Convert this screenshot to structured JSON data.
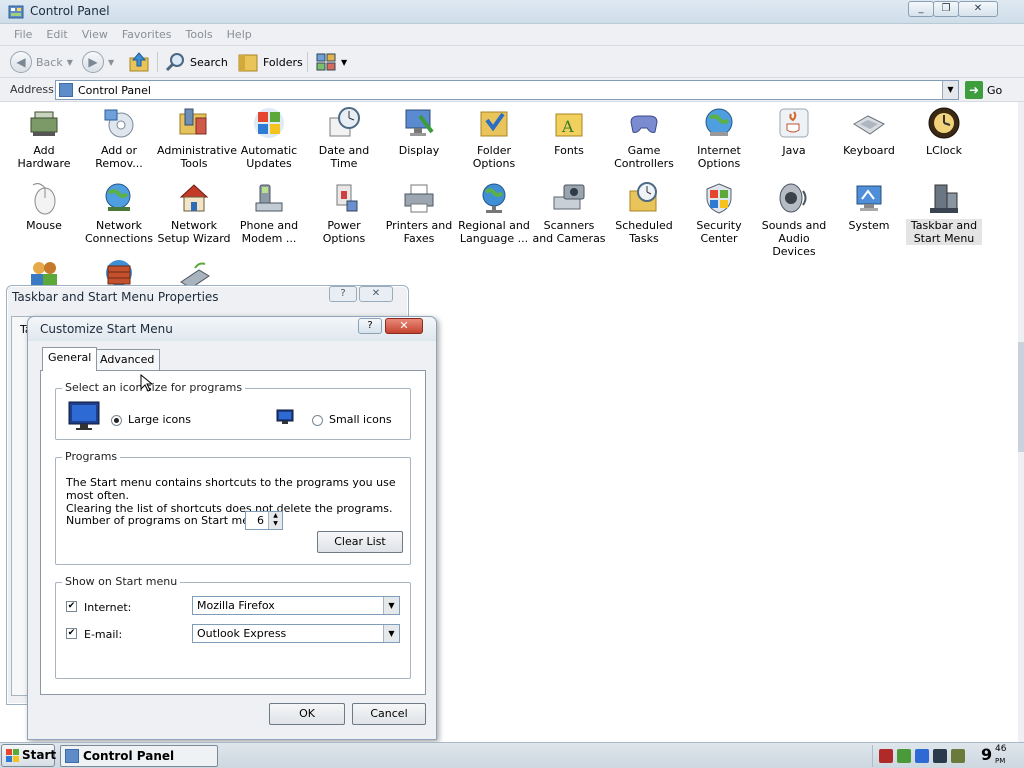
{
  "window": {
    "title": "Control Panel",
    "minimize": "_",
    "restore": "❐",
    "close": "✕"
  },
  "menu": [
    "File",
    "Edit",
    "View",
    "Favorites",
    "Tools",
    "Help"
  ],
  "toolbar": {
    "back": "Back",
    "search": "Search",
    "folders": "Folders"
  },
  "address": {
    "label": "Address",
    "value": "Control Panel",
    "go": "Go"
  },
  "items": [
    {
      "label": "Add Hardware"
    },
    {
      "label": "Add or Remov..."
    },
    {
      "label": "Administrative Tools"
    },
    {
      "label": "Automatic Updates"
    },
    {
      "label": "Date and Time"
    },
    {
      "label": "Display"
    },
    {
      "label": "Folder Options"
    },
    {
      "label": "Fonts"
    },
    {
      "label": "Game Controllers"
    },
    {
      "label": "Internet Options"
    },
    {
      "label": "Java"
    },
    {
      "label": "Keyboard"
    },
    {
      "label": "LClock"
    },
    {
      "label": "Mouse"
    },
    {
      "label": "Network Connections"
    },
    {
      "label": "Network Setup Wizard"
    },
    {
      "label": "Phone and Modem ..."
    },
    {
      "label": "Power Options"
    },
    {
      "label": "Printers and Faxes"
    },
    {
      "label": "Regional and Language ..."
    },
    {
      "label": "Scanners and Cameras"
    },
    {
      "label": "Scheduled Tasks"
    },
    {
      "label": "Security Center"
    },
    {
      "label": "Sounds and Audio Devices"
    },
    {
      "label": "System"
    },
    {
      "label": "Taskbar and Start Menu",
      "selected": true
    },
    {
      "label": ""
    },
    {
      "label": ""
    },
    {
      "label": ""
    }
  ],
  "props_window": {
    "title": "Taskbar and Start Menu Properties",
    "help": "?",
    "close": "✕",
    "tab_partial": "Ta"
  },
  "dialog": {
    "title": "Customize Start Menu",
    "help": "?",
    "close": "✕",
    "tabs": [
      "General",
      "Advanced"
    ],
    "icon_size": {
      "legend": "Select an icon size for programs",
      "large": "Large icons",
      "small": "Small icons",
      "selected": "large"
    },
    "programs": {
      "legend": "Programs",
      "description_1": "The Start menu contains shortcuts to the programs you use most often.",
      "description_2": "Clearing the list of shortcuts does not delete the programs.",
      "count_label": "Number of programs on Start menu:",
      "count": "6",
      "clear": "Clear List"
    },
    "show": {
      "legend": "Show on Start menu",
      "internet_label": "Internet:",
      "internet_checked": true,
      "internet_value": "Mozilla Firefox",
      "email_label": "E-mail:",
      "email_checked": true,
      "email_value": "Outlook Express"
    },
    "ok": "OK",
    "cancel": "Cancel"
  },
  "taskbar": {
    "start": "Start",
    "task": "Control Panel",
    "clock_hour": "9",
    "clock_min": "46",
    "clock_ampm": "PM"
  }
}
